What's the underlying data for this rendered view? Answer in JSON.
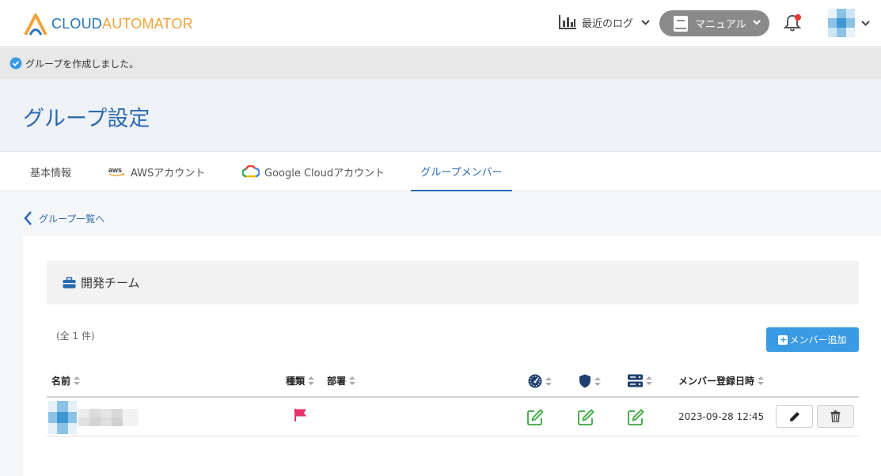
{
  "header": {
    "logo": {
      "part1": "CLOUD",
      "part2": "AUTOMATOR"
    },
    "recent_log_label": "最近のログ",
    "manual_label": "マニュアル",
    "colors": {
      "brand_blue": "#2574bd",
      "brand_orange": "#f2a33a",
      "notification_dot": "#e33"
    }
  },
  "flash": {
    "message": "グループを作成しました。"
  },
  "page_title": "グループ設定",
  "tabs": [
    {
      "label": "基本情報",
      "icon": ""
    },
    {
      "label": "AWSアカウント",
      "icon": "aws-icon"
    },
    {
      "label": "Google Cloudアカウント",
      "icon": "google-cloud-icon"
    },
    {
      "label": "グループメンバー",
      "icon": "",
      "active": true
    }
  ],
  "back_link": "グループ一覧へ",
  "team": {
    "name": "開発チーム"
  },
  "count_text": "(全 1 件)",
  "add_member_label": "メンバー追加",
  "table": {
    "columns": {
      "name": "名前",
      "type": "種類",
      "department": "部署",
      "dashboard_icon": "dashboard-permission-icon",
      "shield_icon": "security-permission-icon",
      "server_icon": "resource-permission-icon",
      "registered": "メンバー登録日時"
    },
    "rows": [
      {
        "name": "",
        "type_icon": "flag-icon",
        "department": "",
        "registered": "2023-09-28 12:45"
      }
    ]
  },
  "colors": {
    "accent": "#2a6ab1",
    "button_blue": "#3a9be3",
    "edit_green": "#4caf50",
    "flag_pink": "#e8336d"
  }
}
